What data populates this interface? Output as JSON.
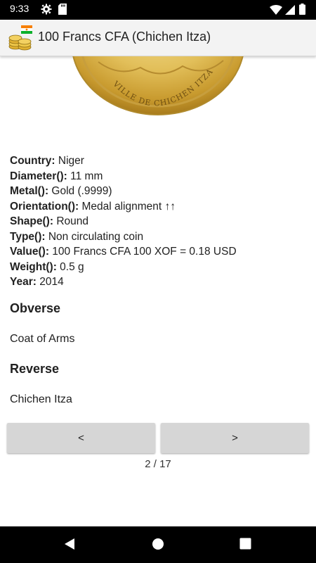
{
  "status_bar": {
    "time": "9:33"
  },
  "app_bar": {
    "title": "100 Francs CFA (Chichen Itza)",
    "flag_colors": [
      "#f77f00",
      "#ffffff",
      "#0db02b"
    ]
  },
  "coin_image": {
    "inscription": "VILLE DE CHICHEN ITZA"
  },
  "details": [
    {
      "key": "Country:",
      "value": "Niger"
    },
    {
      "key": "Diameter():",
      "value": "11 mm"
    },
    {
      "key": "Metal():",
      "value": "Gold (.9999)"
    },
    {
      "key": "Orientation():",
      "value": "Medal alignment ↑↑"
    },
    {
      "key": "Shape():",
      "value": "Round"
    },
    {
      "key": "Type():",
      "value": "Non circulating coin"
    },
    {
      "key": "Value():",
      "value": "100 Francs CFA 100 XOF = 0.18 USD"
    },
    {
      "key": "Weight():",
      "value": "0.5 g"
    },
    {
      "key": "Year:",
      "value": "2014"
    }
  ],
  "obverse": {
    "heading": "Obverse",
    "text": "Coat of Arms"
  },
  "reverse": {
    "heading": "Reverse",
    "text": "Chichen Itza"
  },
  "navigation": {
    "prev_label": "<",
    "next_label": ">",
    "pager": "2 / 17"
  }
}
